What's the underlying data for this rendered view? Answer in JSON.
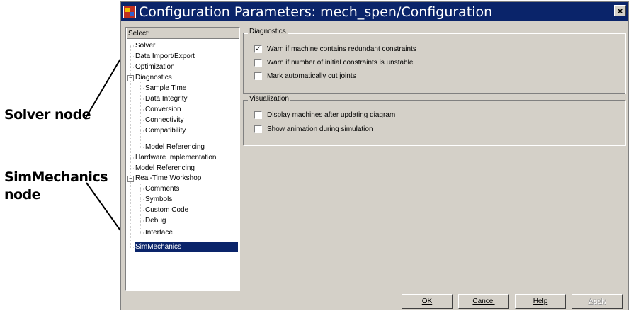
{
  "annotations": {
    "solver_node": "Solver node",
    "simmechanics_line1": "SimMechanics",
    "simmechanics_line2": "node"
  },
  "window": {
    "title": "Configuration Parameters: mech_spen/Configuration",
    "close_glyph": "×"
  },
  "tree": {
    "label": "Select:",
    "items": [
      {
        "label": "Solver"
      },
      {
        "label": "Data Import/Export"
      },
      {
        "label": "Optimization"
      },
      {
        "label": "Diagnostics",
        "expanded": true
      },
      {
        "label": "Sample Time"
      },
      {
        "label": "Data Integrity"
      },
      {
        "label": "Conversion"
      },
      {
        "label": "Connectivity"
      },
      {
        "label": "Compatibility"
      },
      {
        "label": "Model Referencing"
      },
      {
        "label": "Hardware Implementation"
      },
      {
        "label": "Model Referencing"
      },
      {
        "label": "Real-Time Workshop",
        "expanded": true
      },
      {
        "label": "Comments"
      },
      {
        "label": "Symbols"
      },
      {
        "label": "Custom Code"
      },
      {
        "label": "Debug"
      },
      {
        "label": "Interface"
      },
      {
        "label": "SimMechanics",
        "selected": true
      }
    ]
  },
  "diagnostics": {
    "title": "Diagnostics",
    "options": [
      {
        "label": "Warn if machine contains redundant constraints",
        "checked": true
      },
      {
        "label": "Warn if number of initial constraints is unstable",
        "checked": false
      },
      {
        "label": "Mark automatically cut joints",
        "checked": false
      }
    ]
  },
  "visualization": {
    "title": "Visualization",
    "options": [
      {
        "label": "Display machines after updating diagram",
        "checked": false
      },
      {
        "label": "Show animation during simulation",
        "checked": false
      }
    ]
  },
  "buttons": {
    "ok": "OK",
    "cancel": "Cancel",
    "help": "Help",
    "apply": "Apply"
  },
  "colors": {
    "titlebar": "#0a246a",
    "dialog_face": "#d4d0c8",
    "selection": "#0a246a"
  }
}
